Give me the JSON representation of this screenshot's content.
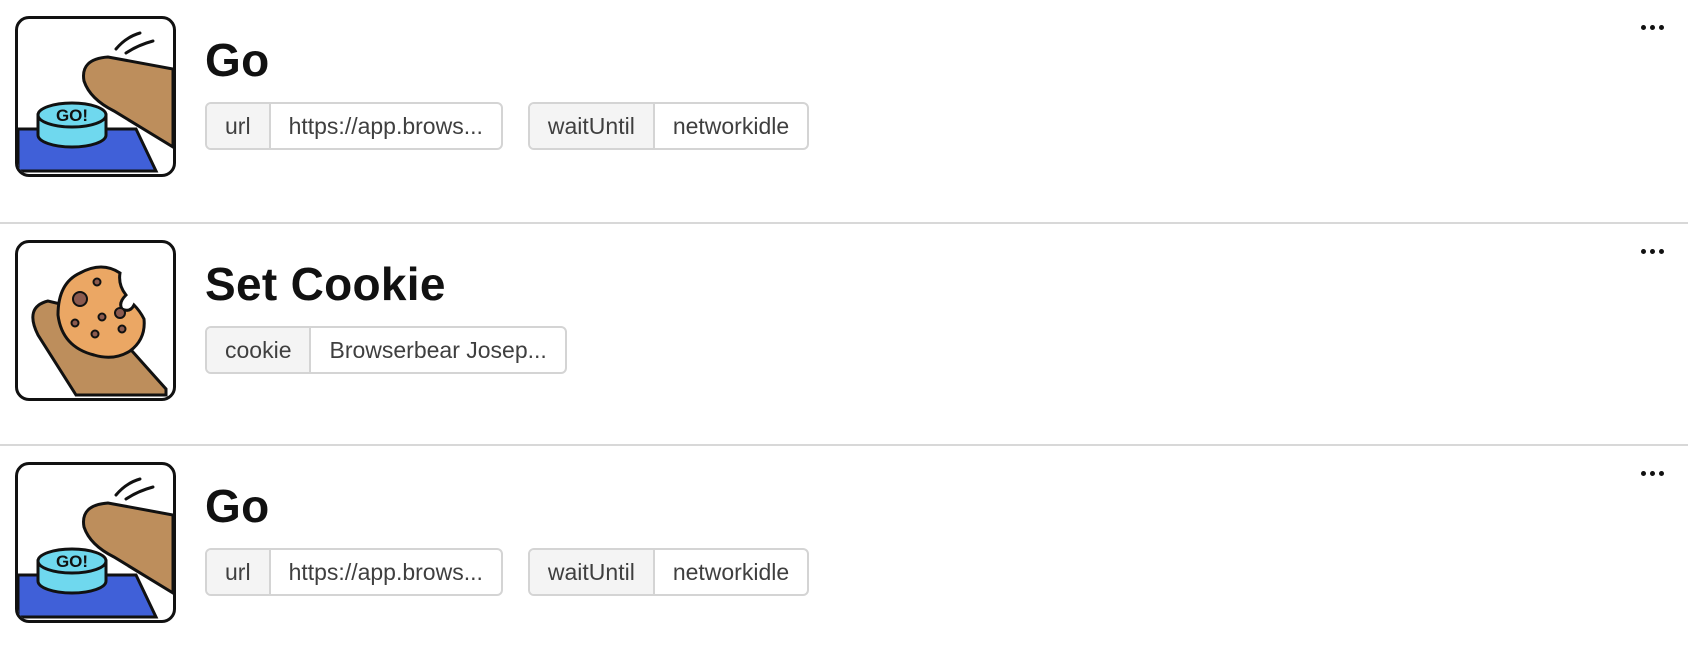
{
  "steps": [
    {
      "icon": "go-button-icon",
      "title": "Go",
      "params": [
        {
          "key": "url",
          "value": "https://app.brows..."
        },
        {
          "key": "waitUntil",
          "value": "networkidle"
        }
      ],
      "thumb_text": "GO!"
    },
    {
      "icon": "cookie-icon",
      "title": "Set Cookie",
      "params": [
        {
          "key": "cookie",
          "value": "Browserbear Josep..."
        }
      ]
    },
    {
      "icon": "go-button-icon",
      "title": "Go",
      "params": [
        {
          "key": "url",
          "value": "https://app.brows..."
        },
        {
          "key": "waitUntil",
          "value": "networkidle"
        }
      ],
      "thumb_text": "GO!"
    }
  ],
  "colors": {
    "finger": "#bd8e5c",
    "go_button": "#6fd8ee",
    "table_blue": "#4060d8",
    "cookie": "#eba764",
    "chip_dot": "#8b5a4e"
  }
}
